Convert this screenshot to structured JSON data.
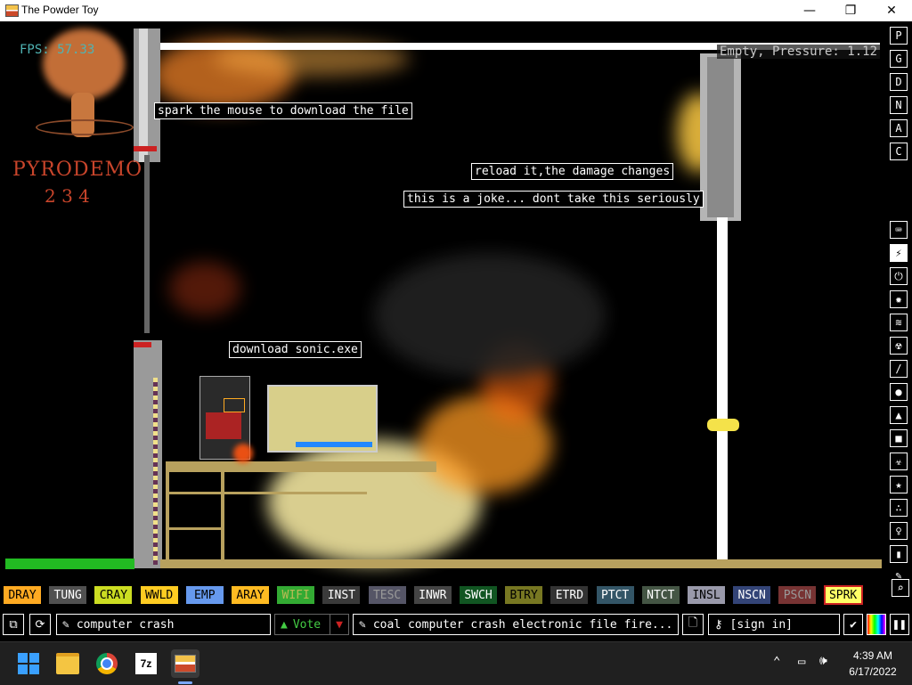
{
  "window": {
    "title": "The Powder Toy",
    "controls": [
      "—",
      "❐",
      "✕"
    ]
  },
  "canvas": {
    "fps": "FPS: 57.33",
    "status": "Empty, Pressure: 1.12",
    "logo": {
      "line1": "PYRODEMO",
      "line2": "2 3 4"
    },
    "signs": [
      "spark the mouse to download the file",
      "reload it,the damage changes",
      "this is a joke... dont take this seriously",
      "download sonic.exe"
    ]
  },
  "right_menu": {
    "top_buttons": [
      "P",
      "G",
      "D",
      "N",
      "A",
      "C"
    ],
    "category_icons": [
      "keyboard-icon",
      "plug-icon",
      "power-icon",
      "explosive-icon",
      "gas-icon",
      "nuclear-icon",
      "brush-icon",
      "liquid-icon",
      "powder-icon",
      "solid-icon",
      "radiation-icon",
      "star-icon",
      "particles-icon",
      "bulb-icon",
      "bookmark-icon",
      "pen-icon",
      "search-icon"
    ]
  },
  "elements": [
    {
      "label": "DRAY",
      "bg": "#ffaa22",
      "fg": "#000000"
    },
    {
      "label": "TUNG",
      "bg": "#505050",
      "fg": "#ffffff"
    },
    {
      "label": "CRAY",
      "bg": "#ccdd22",
      "fg": "#000000"
    },
    {
      "label": "WWLD",
      "bg": "#ffcc22",
      "fg": "#000000"
    },
    {
      "label": "EMP",
      "bg": "#6699ee",
      "fg": "#000000"
    },
    {
      "label": "ARAY",
      "bg": "#ffbb22",
      "fg": "#000000"
    },
    {
      "label": "WIFI",
      "bg": "#33aa33",
      "fg": "#bbbb55"
    },
    {
      "label": "INST",
      "bg": "#3a3a3a",
      "fg": "#ffffff"
    },
    {
      "label": "TESC",
      "bg": "#555566",
      "fg": "#999999"
    },
    {
      "label": "INWR",
      "bg": "#444444",
      "fg": "#ffffff"
    },
    {
      "label": "SWCH",
      "bg": "#115522",
      "fg": "#ffffff"
    },
    {
      "label": "BTRY",
      "bg": "#777722",
      "fg": "#000000"
    },
    {
      "label": "ETRD",
      "bg": "#333333",
      "fg": "#ffffff"
    },
    {
      "label": "PTCT",
      "bg": "#335566",
      "fg": "#ffffff"
    },
    {
      "label": "NTCT",
      "bg": "#445544",
      "fg": "#ffffff"
    },
    {
      "label": "INSL",
      "bg": "#9999aa",
      "fg": "#000000"
    },
    {
      "label": "NSCN",
      "bg": "#334477",
      "fg": "#ffffff"
    },
    {
      "label": "PSCN",
      "bg": "#773333",
      "fg": "#999999"
    },
    {
      "label": "SPRK",
      "bg": "#ffff66",
      "fg": "#000000",
      "selected": true
    }
  ],
  "bottom": {
    "save_name": "computer crash",
    "vote_label": "Vote",
    "tags": "coal computer crash electronic file fire...",
    "sign_in": "[sign in]"
  },
  "taskbar": {
    "apps": [
      "windows-start-icon",
      "file-explorer-icon",
      "chrome-icon",
      "7zip-icon",
      "powder-toy-icon"
    ],
    "seven_zip_label": "7z",
    "time": "4:39 AM",
    "date": "6/17/2022"
  }
}
